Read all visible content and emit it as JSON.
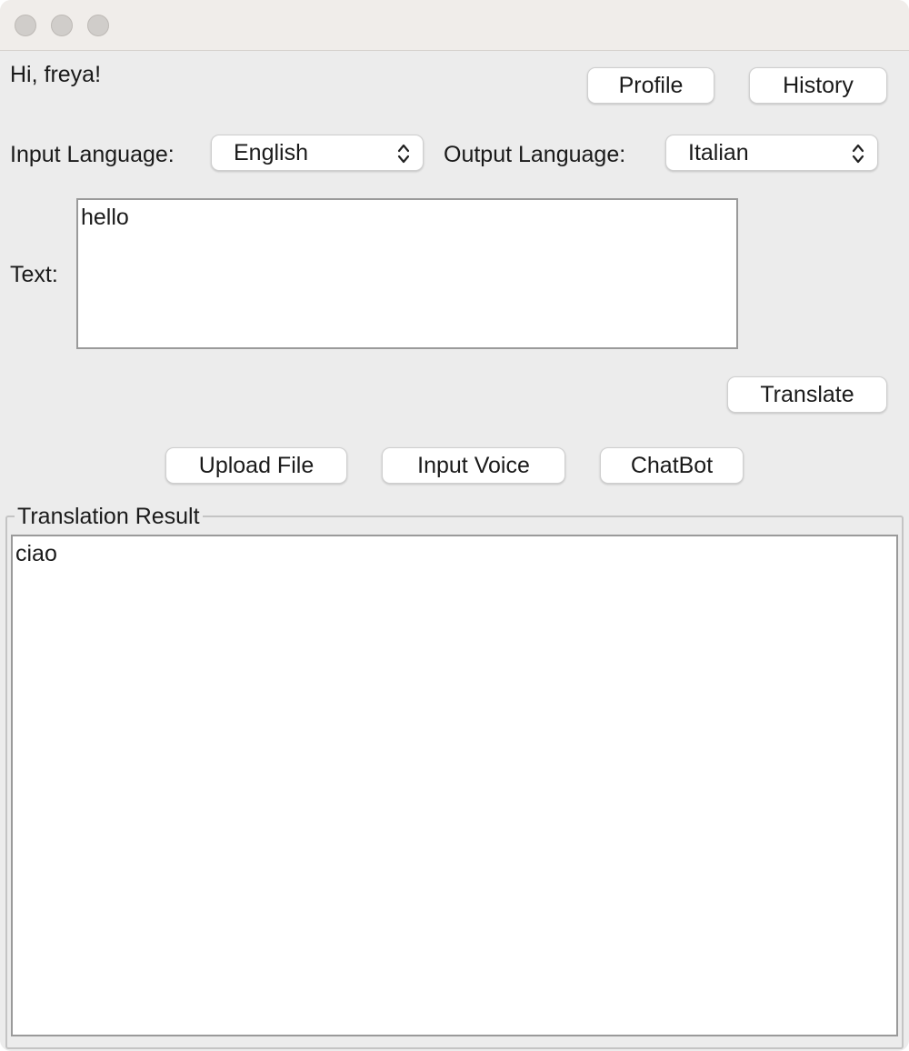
{
  "window": {
    "controls": [
      "close-button",
      "minimize-button",
      "zoom-button"
    ]
  },
  "header": {
    "greeting": "Hi, freya!",
    "profile_label": "Profile",
    "history_label": "History"
  },
  "languages": {
    "input_label": "Input Language:",
    "input_value": "English",
    "output_label": "Output Language:",
    "output_value": "Italian"
  },
  "input": {
    "label": "Text:",
    "value": "hello"
  },
  "actions": {
    "translate_label": "Translate",
    "upload_label": "Upload File",
    "voice_label": "Input Voice",
    "chatbot_label": "ChatBot"
  },
  "result": {
    "title": "Translation Result",
    "value": "ciao"
  },
  "icons": {
    "select_arrows": "chevron-up-down-icon"
  }
}
